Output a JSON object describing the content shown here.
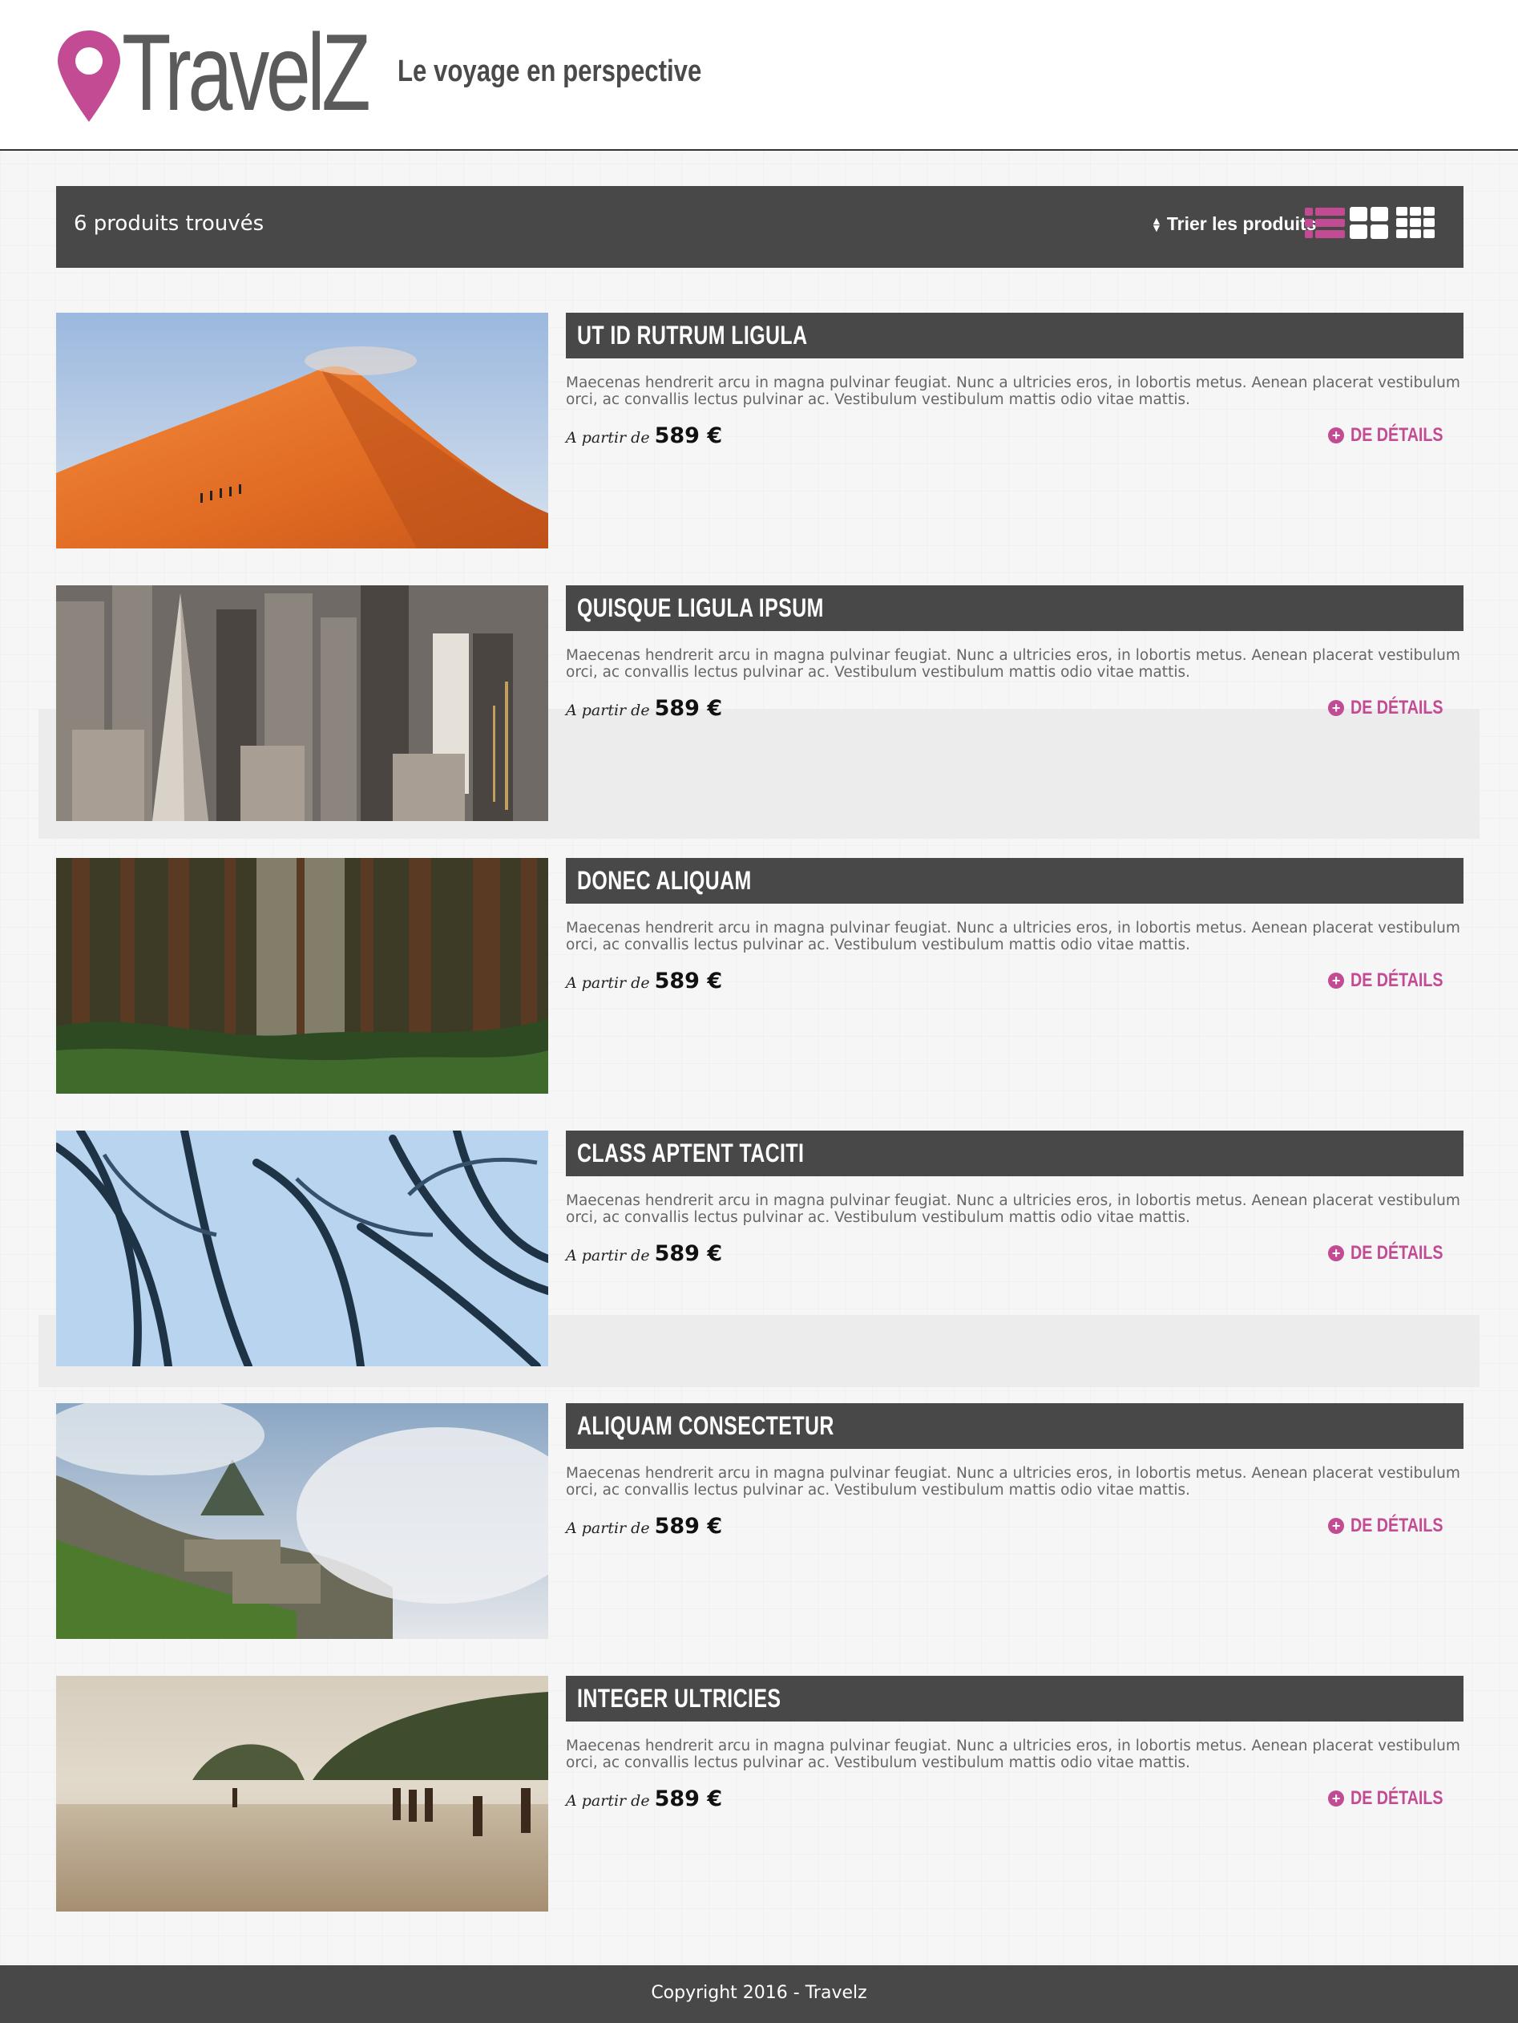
{
  "header": {
    "logo_text": "TravelZ",
    "tagline": "Le voyage en perspective"
  },
  "toolbar": {
    "result_count": "6 produits trouvés",
    "sort_label": "Trier les produits"
  },
  "colors": {
    "accent": "#c24b93",
    "dark_bar": "#484848",
    "background": "#f7f6f6"
  },
  "products": [
    {
      "title": "UT ID RUTRUM LIGULA",
      "description": "Maecenas hendrerit arcu in magna pulvinar feugiat. Nunc a ultricies eros, in lobortis metus. Aenean placerat vestibulum orci, ac convallis lectus pulvinar ac. Vestibulum vestibulum mattis odio vitae mattis.",
      "price_prefix": "A partir de",
      "price": "589 €",
      "details_label": "DE DÉTAILS",
      "image": "desert-dune-photo"
    },
    {
      "title": "QUISQUE LIGULA IPSUM",
      "description": "Maecenas hendrerit arcu in magna pulvinar feugiat. Nunc a ultricies eros, in lobortis metus. Aenean placerat vestibulum orci, ac convallis lectus pulvinar ac. Vestibulum vestibulum mattis odio vitae mattis.",
      "price_prefix": "A partir de",
      "price": "589 €",
      "details_label": "DE DÉTAILS",
      "image": "city-skyline-photo"
    },
    {
      "title": "DONEC ALIQUAM",
      "description": "Maecenas hendrerit arcu in magna pulvinar feugiat. Nunc a ultricies eros, in lobortis metus. Aenean placerat vestibulum orci, ac convallis lectus pulvinar ac. Vestibulum vestibulum mattis odio vitae mattis.",
      "price_prefix": "A partir de",
      "price": "589 €",
      "details_label": "DE DÉTAILS",
      "image": "forest-photo"
    },
    {
      "title": "CLASS APTENT TACITI",
      "description": "Maecenas hendrerit arcu in magna pulvinar feugiat. Nunc a ultricies eros, in lobortis metus. Aenean placerat vestibulum orci, ac convallis lectus pulvinar ac. Vestibulum vestibulum mattis odio vitae mattis.",
      "price_prefix": "A partir de",
      "price": "589 €",
      "details_label": "DE DÉTAILS",
      "image": "palm-trees-photo"
    },
    {
      "title": "ALIQUAM CONSECTETUR",
      "description": "Maecenas hendrerit arcu in magna pulvinar feugiat. Nunc a ultricies eros, in lobortis metus. Aenean placerat vestibulum orci, ac convallis lectus pulvinar ac. Vestibulum vestibulum mattis odio vitae mattis.",
      "price_prefix": "A partir de",
      "price": "589 €",
      "details_label": "DE DÉTAILS",
      "image": "mountain-ruins-photo"
    },
    {
      "title": "INTEGER ULTRICIES",
      "description": "Maecenas hendrerit arcu in magna pulvinar feugiat. Nunc a ultricies eros, in lobortis metus. Aenean placerat vestibulum orci, ac convallis lectus pulvinar ac. Vestibulum vestibulum mattis odio vitae mattis.",
      "price_prefix": "A partir de",
      "price": "589 €",
      "details_label": "DE DÉTAILS",
      "image": "beach-photo"
    }
  ],
  "footer": {
    "copyright": "Copyright 2016 - Travelz"
  }
}
